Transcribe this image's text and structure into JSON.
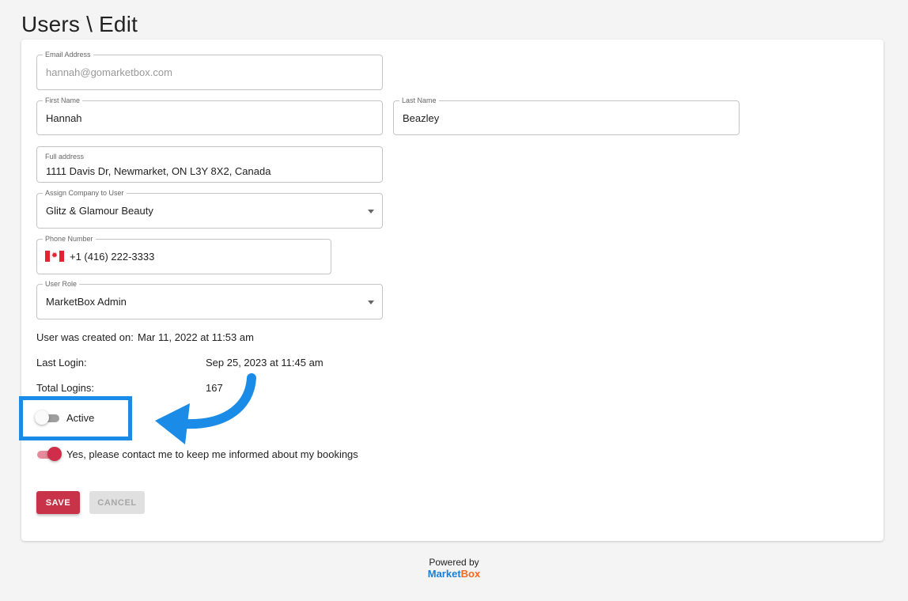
{
  "page": {
    "title": "Users \\ Edit"
  },
  "form": {
    "email": {
      "label": "Email Address",
      "value": "hannah@gomarketbox.com"
    },
    "first_name": {
      "label": "First Name",
      "value": "Hannah"
    },
    "last_name": {
      "label": "Last Name",
      "value": "Beazley"
    },
    "address": {
      "label": "Full address",
      "value": "1111 Davis Dr, Newmarket, ON L3Y 8X2, Canada"
    },
    "company": {
      "label": "Assign Company to User",
      "value": "Glitz & Glamour Beauty"
    },
    "phone": {
      "label": "Phone Number",
      "value": "+1 (416) 222-3333",
      "flag_icon": "canada-flag-icon"
    },
    "role": {
      "label": "User Role",
      "value": "MarketBox Admin"
    }
  },
  "info": {
    "created_label": "User was created on:",
    "created_value": "Mar 11, 2022 at 11:53 am",
    "last_login_label": "Last Login:",
    "last_login_value": "Sep 25, 2023 at 11:45 am",
    "total_logins_label": "Total Logins:",
    "total_logins_value": "167"
  },
  "toggles": {
    "active": {
      "label": "Active",
      "checked": false
    },
    "contact": {
      "label": "Yes, please contact me to keep me informed about my bookings",
      "checked": true
    }
  },
  "buttons": {
    "save": "SAVE",
    "cancel": "CANCEL"
  },
  "footer": {
    "powered_by": "Powered by",
    "logo_part1": "Market",
    "logo_part2": "Box"
  },
  "colors": {
    "accent": "#c8334a",
    "annotation_blue": "#1a8ce8",
    "logo_blue": "#1a7fd6",
    "logo_orange": "#f26a21"
  }
}
